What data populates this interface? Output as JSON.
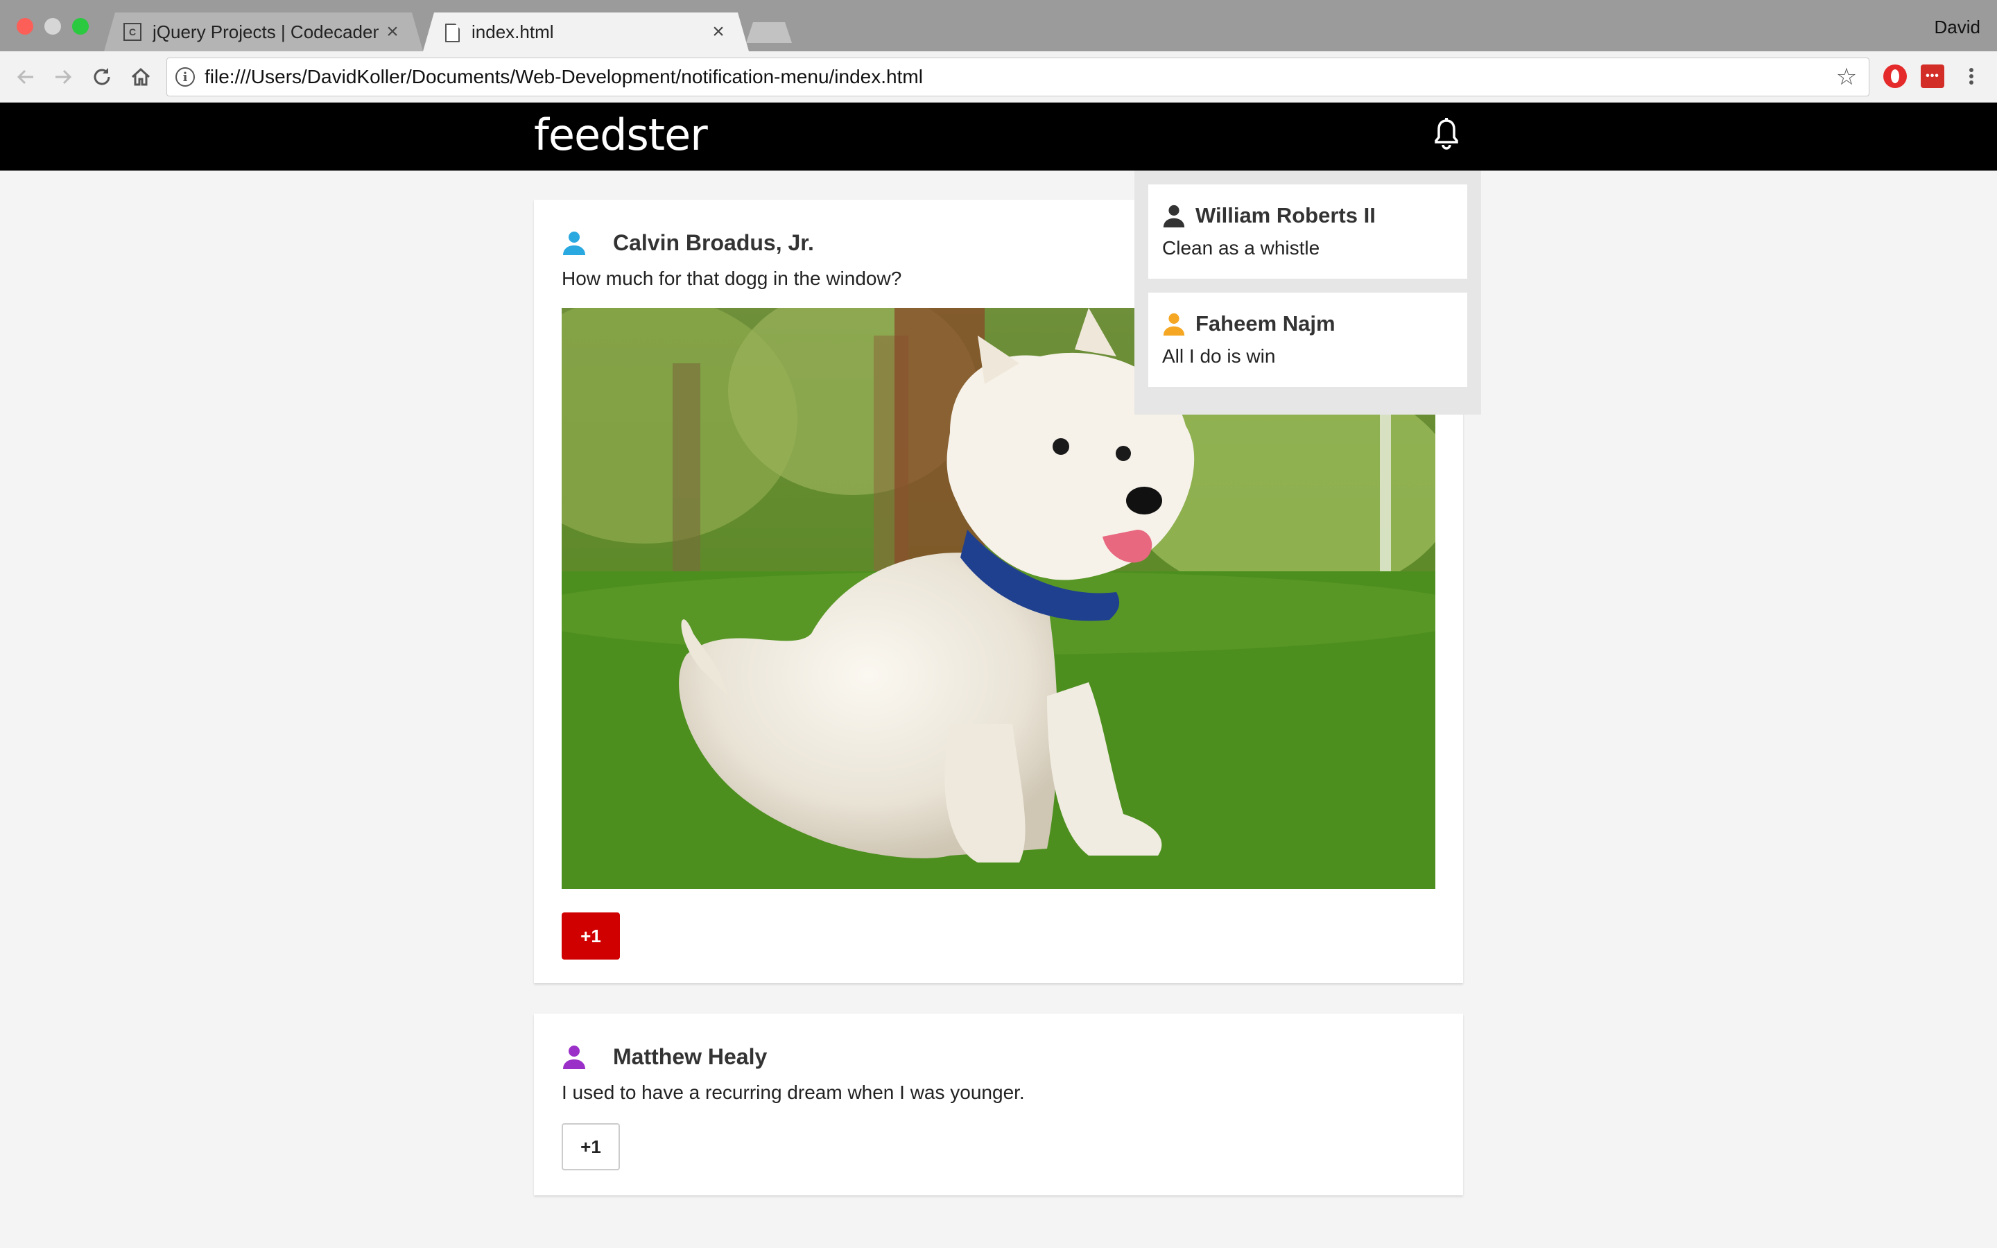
{
  "browser": {
    "tabs": [
      {
        "title": "jQuery Projects | Codecademy",
        "favicon": "codecademy-icon",
        "active": false
      },
      {
        "title": "index.html",
        "favicon": "document-icon",
        "active": true
      }
    ],
    "close_glyph": "×",
    "profile_name": "David",
    "url": "file:///Users/DavidKoller/Documents/Web-Development/notification-menu/index.html",
    "lastpass_glyph": "•••"
  },
  "site": {
    "logo": "feedster"
  },
  "notifications": [
    {
      "name": "William Roberts II",
      "text": "Clean as a whistle",
      "icon_color": "#333333"
    },
    {
      "name": "Faheem Najm",
      "text": "All I do is win",
      "icon_color": "#f5a623"
    }
  ],
  "posts": [
    {
      "author": "Calvin Broadus, Jr.",
      "text": "How much for that dogg in the window?",
      "icon_color": "#2aa8e0",
      "plus_label": "+1",
      "has_image": true
    },
    {
      "author": "Matthew Healy",
      "text": "I used to have a recurring dream when I was younger.",
      "icon_color": "#9b30c8",
      "plus_label": "+1",
      "has_image": false
    }
  ],
  "colors": {
    "header_bg": "#000000",
    "liked_button": "#d10000",
    "page_bg": "#f4f4f4",
    "panel_bg": "#e6e6e6"
  }
}
